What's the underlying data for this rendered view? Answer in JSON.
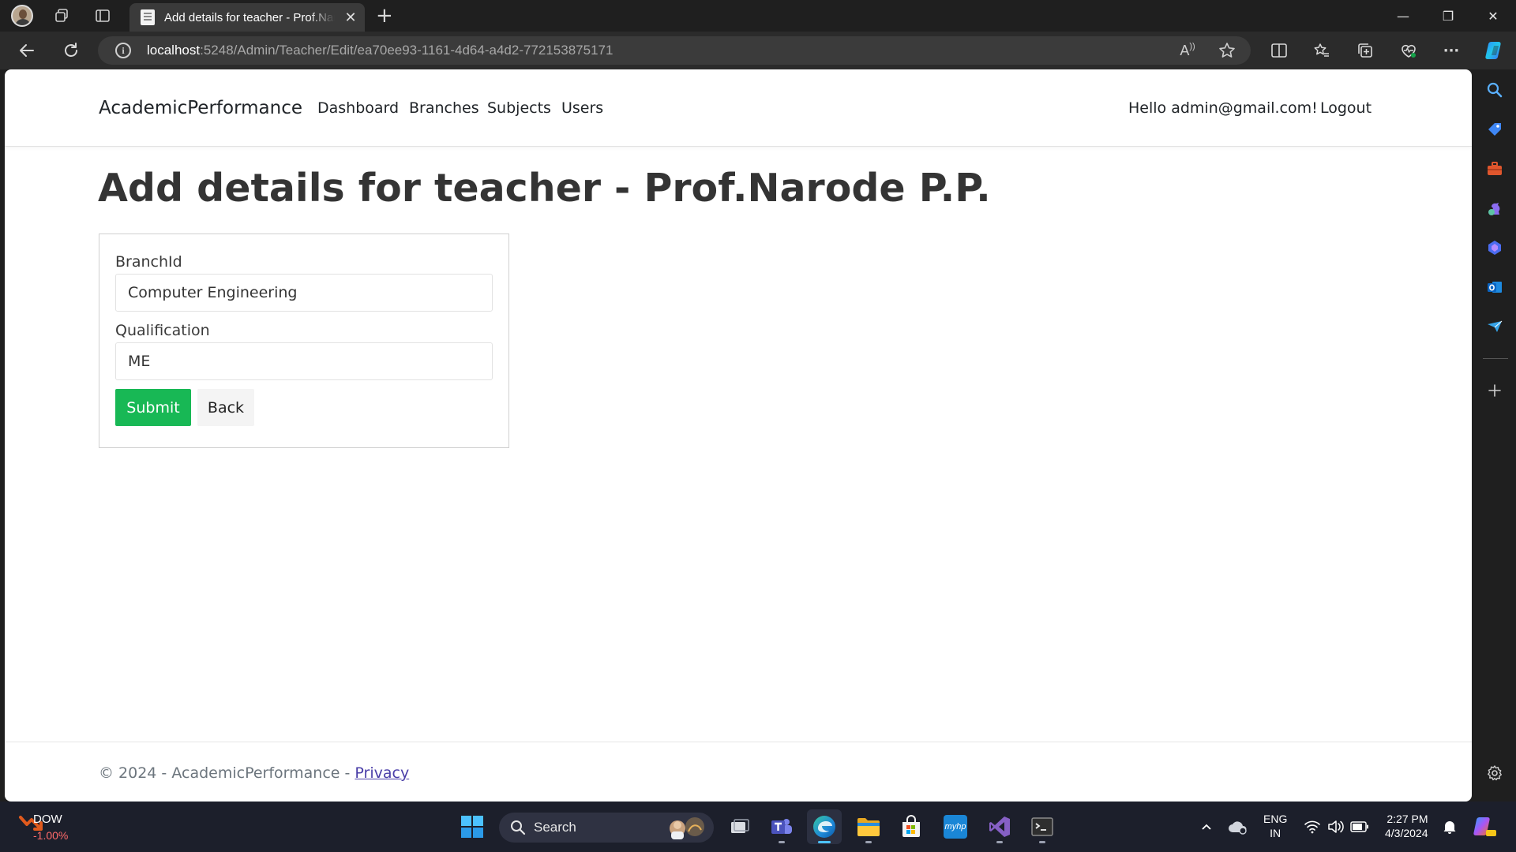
{
  "browser": {
    "tab_title": "Add details for teacher - Prof.Narode P.P.",
    "tab_close": "✕",
    "new_tab": "+",
    "url_host": "localhost",
    "url_rest": ":5248/Admin/Teacher/Edit/ea70ee93-1161-4d64-a4d2-772153875171",
    "read_aloud_label": "A",
    "window_controls": {
      "minimize": "—",
      "restore": "❐",
      "close": "✕"
    },
    "more_label": "···"
  },
  "site": {
    "brand": "AcademicPerformance",
    "nav": {
      "dashboard": "Dashboard",
      "branches": "Branches",
      "subjects": "Subjects",
      "users": "Users"
    },
    "greeting": "Hello admin@gmail.com!",
    "logout": "Logout"
  },
  "main": {
    "title": "Add details for teacher - Prof.Narode P.P.",
    "form": {
      "branch_label": "BranchId",
      "branch_value": "Computer Engineering",
      "qualification_label": "Qualification",
      "qualification_value": "ME",
      "submit_label": "Submit",
      "back_label": "Back"
    }
  },
  "footer": {
    "text": "© 2024 - AcademicPerformance - ",
    "privacy_link": "Privacy"
  },
  "taskbar": {
    "stock_name": "DOW",
    "stock_change": "-1.00%",
    "search_label": "Search",
    "language_line1": "ENG",
    "language_line2": "IN",
    "time": "2:27 PM",
    "date": "4/3/2024",
    "myhp_label": "myhp"
  },
  "colors": {
    "submit_button": "#18b855",
    "stock_down": "#ff6a6a",
    "footer_link": "#4a3ea8",
    "taskbar_bg": "#1c1f2b"
  }
}
